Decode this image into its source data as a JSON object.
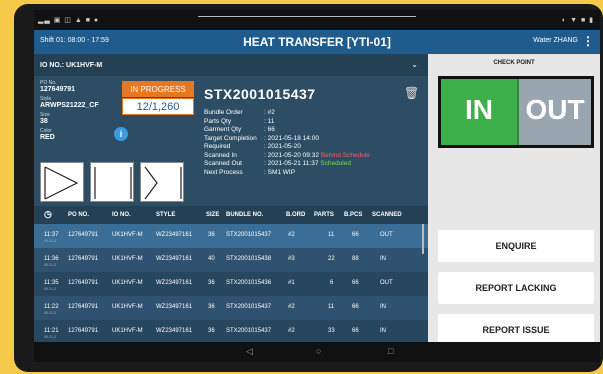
{
  "status_bar": {
    "left": "▂▃ ▣ ◫ ▲ ■ ●",
    "right": "◐ ▼ ■ ▮"
  },
  "app": {
    "shift": "Shift 01: 08:00 - 17:59",
    "title": "HEAT TRANSFER [YTI-01]",
    "user": "Water ZHANG",
    "menu": "⋮"
  },
  "io_bar": {
    "label": "IO NO.: UK1HVF-M",
    "chevron": "⌄"
  },
  "card": {
    "po_label": "PO No.",
    "po_value": "127649791",
    "style_label": "Style",
    "style_value": "ARWPS21222_CF",
    "size_label": "Size",
    "size_value": "38",
    "color_label": "Color",
    "color_value": "RED",
    "status": "IN PROGRESS",
    "progress": "12/1,260",
    "info": "i",
    "bundle_no": "STX2001015437",
    "trash": "🗑",
    "details": [
      {
        "k": "Bundle Order",
        "v": ": #2",
        "note": "",
        "note_color": ""
      },
      {
        "k": "Parts Qty",
        "v": ": 11",
        "note": "",
        "note_color": ""
      },
      {
        "k": "Garment Qty",
        "v": ": 66",
        "note": "",
        "note_color": ""
      },
      {
        "k": "Target Completion",
        "v": ": 2021-05-18 14:00",
        "note": "",
        "note_color": ""
      },
      {
        "k": "Required",
        "v": ": 2021-05-20",
        "note": "",
        "note_color": ""
      },
      {
        "k": "Scanned In",
        "v": ": 2021-05-20 09:32",
        "note": "Behind Schedule",
        "note_color": "red"
      },
      {
        "k": "Scanned Out",
        "v": ": 2021-05-21 11:37",
        "note": "Scheduled",
        "note_color": "green"
      },
      {
        "k": "Next Process",
        "v": ": SM1 WIP",
        "note": "",
        "note_color": ""
      }
    ]
  },
  "table": {
    "headers": [
      "PO NO.",
      "IO NO.",
      "STYLE",
      "SIZE",
      "BUNDLE NO.",
      "B.ORD",
      "PARTS",
      "B.PCS",
      "SCANNED"
    ],
    "clock_icon": "◷",
    "rows": [
      {
        "time": "11:37",
        "sub": "05-21-2",
        "po": "127649791",
        "io": "UK1HVF-M",
        "style": "WZ23497161",
        "size": "36",
        "bundle": "STX2001015437",
        "bord": "#2",
        "parts": "11",
        "bpcs": "66",
        "scanned": "OUT"
      },
      {
        "time": "11:36",
        "sub": "05-21-2",
        "po": "127649791",
        "io": "UK1HVF-M",
        "style": "WZ23497161",
        "size": "40",
        "bundle": "STX2001015438",
        "bord": "#3",
        "parts": "22",
        "bpcs": "88",
        "scanned": "IN"
      },
      {
        "time": "11:35",
        "sub": "05-21-2",
        "po": "127649791",
        "io": "UK1HVF-M",
        "style": "WZ23497161",
        "size": "36",
        "bundle": "STX2001015436",
        "bord": "#1",
        "parts": "6",
        "bpcs": "66",
        "scanned": "OUT"
      },
      {
        "time": "11:22",
        "sub": "05-21-2",
        "po": "127649791",
        "io": "UK1HVF-M",
        "style": "WZ23497161",
        "size": "36",
        "bundle": "STX2001015437",
        "bord": "#2",
        "parts": "11",
        "bpcs": "66",
        "scanned": "IN"
      },
      {
        "time": "11:21",
        "sub": "05-21-2",
        "po": "127649791",
        "io": "UK1HVF-M",
        "style": "WZ23497161",
        "size": "36",
        "bundle": "STX2001015437",
        "bord": "#2",
        "parts": "33",
        "bpcs": "66",
        "scanned": "IN"
      }
    ]
  },
  "checkpoint": {
    "title": "CHECK POINT",
    "in_label": "IN",
    "out_label": "OUT"
  },
  "actions": {
    "enquire": "ENQUIRE",
    "report_lacking": "REPORT LACKING",
    "report_issue": "REPORT ISSUE"
  },
  "navbar": {
    "back": "◁",
    "home": "○",
    "recent": "□"
  },
  "colors": {
    "appbar": "#1f5b8c",
    "in_progress": "#e87722",
    "in_button": "#3db04b",
    "out_button": "#9aa6af",
    "behind_schedule": "#ff5b5b",
    "scheduled": "#6ee05a"
  }
}
